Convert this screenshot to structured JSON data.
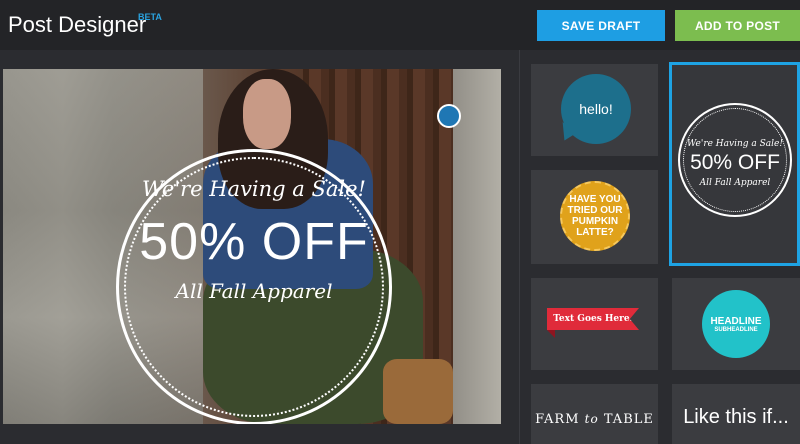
{
  "header": {
    "title": "Post Designer",
    "badge": "BETA",
    "save_draft_label": "SAVE DRAFT",
    "add_to_post_label": "ADD TO POST"
  },
  "canvas": {
    "overlay_line1": "We're Having a Sale!",
    "overlay_line2": "50% OFF",
    "overlay_line3": "All Fall Apparel"
  },
  "templates": [
    {
      "text": "hello!"
    },
    {
      "line1": "We're Having a Sale!",
      "line2": "50% OFF",
      "line3": "All Fall Apparel",
      "selected": true
    },
    {
      "text": "HAVE YOU TRIED OUR PUMPKIN LATTE?"
    },
    {
      "text": "Text Goes Here."
    },
    {
      "line1": "HEADLINE",
      "line2": "SUBHEADLINE"
    },
    {
      "text_a": "FARM",
      "text_b": "to",
      "text_c": "TABLE"
    },
    {
      "text": "Like this if..."
    }
  ],
  "colors": {
    "accent": "#1e9ee3",
    "add_to_post": "#7cbd4f",
    "background": "#2b2c30"
  }
}
